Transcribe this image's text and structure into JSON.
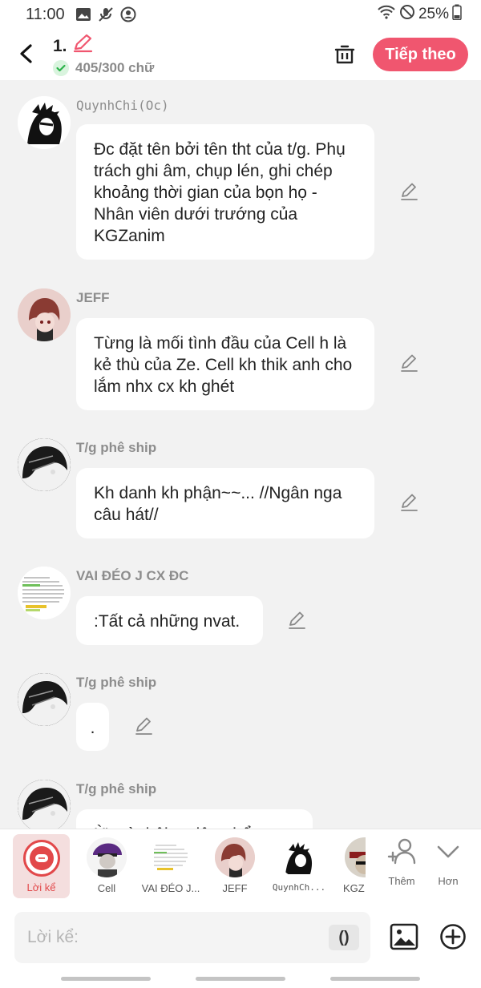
{
  "status_bar": {
    "time": "11:00",
    "battery": "25%",
    "icons": [
      "image-icon",
      "mute-icon",
      "account-icon",
      "wifi-icon",
      "dnd-icon",
      "battery-icon"
    ]
  },
  "header": {
    "chapter_title": "1.",
    "word_count": "405/300 chữ",
    "next_label": "Tiếp theo",
    "accent_color": "#f0566f"
  },
  "messages": [
    {
      "sender": "QuynhChi(Oc)",
      "text": "Đc đặt tên bởi tên tht của t/g. Phụ trách ghi âm, chụp lén, ghi chép khoảng thời gian của bọn họ - Nhân viên dưới trướng của KGZanim"
    },
    {
      "sender": "JEFF",
      "text": "Từng là mối tình đầu của Cell h là kẻ thù của Ze. Cell kh thik anh cho lắm nhx cx kh ghét"
    },
    {
      "sender": "T/g phê ship",
      "text": "Kh danh kh phận~~... //Ngân nga câu hát//"
    },
    {
      "sender": "VAI ĐÉO J CX ĐC",
      "text": ":Tất cả những nvat."
    },
    {
      "sender": "T/g phê ship",
      "text": "."
    },
    {
      "sender": "T/g phê ship",
      "text": "Ừ mà thôi ... tiên nhổ"
    }
  ],
  "characters": {
    "narrator_label": "Lời kể",
    "items": [
      {
        "label": "Cell"
      },
      {
        "label": "VAI ĐÉO J..."
      },
      {
        "label": "JEFF"
      },
      {
        "label": "QuynhCh..."
      },
      {
        "label": "KGZ"
      }
    ],
    "add_label": "Thêm",
    "more_label": "Hơn"
  },
  "input": {
    "placeholder": "Lời kể:",
    "paren_label": "()"
  }
}
